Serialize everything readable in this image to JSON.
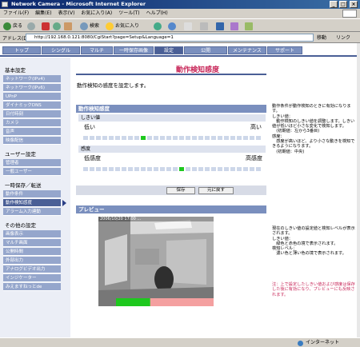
{
  "window": {
    "title": "Network Camera - Microsoft Internet Explorer"
  },
  "menu": [
    "ファイル(F)",
    "編集(E)",
    "表示(V)",
    "お気に入り(A)",
    "ツール(T)",
    "ヘルプ(H)"
  ],
  "toolbar": {
    "back_label": "戻る",
    "search_label": "検索",
    "favorites_label": "お気に入り"
  },
  "address": {
    "label": "アドレス(D)",
    "url": "http://192.168.0.121:8080/CgiStart?page=Setup&Language=1",
    "go_label": "移動",
    "links_label": "リンク"
  },
  "tabs": [
    "トップ",
    "シングル",
    "マルチ",
    "一時保存画像",
    "設定",
    "公開",
    "メンテナンス",
    "サポート"
  ],
  "active_tab_index": 4,
  "sidebar": {
    "basic_heading": "基本設定",
    "basic_items": [
      "ネットワーク(IPv4)",
      "ネットワーク(IPv6)",
      "UPnP",
      "ダイナミックDNS",
      "日付時刻",
      "カメラ",
      "音声",
      "映像配信"
    ],
    "user_heading": "ユーザー設定",
    "user_items": [
      "管理者",
      "一般ユーザー"
    ],
    "buffer_heading": "一時保存／転送",
    "buffer_items": [
      "動作条件",
      "動作検知感度",
      "アラーム入力連動"
    ],
    "active_buffer_index": 1,
    "other_heading": "その他の設定",
    "other_items": [
      "画像表示",
      "マルチ画面",
      "公開時間",
      "外部出力",
      "アナログビデオ出力",
      "インジケーター",
      "みえますねっとde"
    ]
  },
  "main": {
    "title": "動作検知感度",
    "description": "動作検知の感度を設定します。",
    "section_title": "動作検知感度",
    "threshold": {
      "label": "しきい値",
      "low": "低い",
      "high": "高い",
      "level": 0.33
    },
    "sensitivity": {
      "label": "感度",
      "low": "低感度",
      "high": "高感度",
      "level": 0.56
    },
    "save_button": "保存",
    "reset_button": "元に戻す",
    "preview_title": "プレビュー",
    "preview_overlay": "2006/10/20 17:00 ...",
    "preview_bar": {
      "green_fraction": 0.35
    }
  },
  "notes": {
    "settings": "動作条件が動作検知のときに有効になります。\nしきい値：\n　動作検知のしきい値を調整します。しきい値が低いほど小さな変化で検知します。\n　(初期値：左から3番目)\n感度：\n　感度が高いほど、より小さな動きを検知できるようになります。\n　(初期値：中央)",
    "preview": "現在のしきい値の設定値と検知レベルが表示されます。\nしきい値：\n　緑色と赤色の境で表示されます。\n検知レベル：\n　濃い色と薄い色の境で表示されます。",
    "warning": "注：上で設定したしきい値および感度は保存した後に有効になり、プレビューにも反映されます。"
  },
  "status": {
    "left": "",
    "right": "インターネット"
  },
  "colors": {
    "accent": "#4a5f96",
    "title": "#c8285a",
    "level_on": "#1ec81e"
  }
}
